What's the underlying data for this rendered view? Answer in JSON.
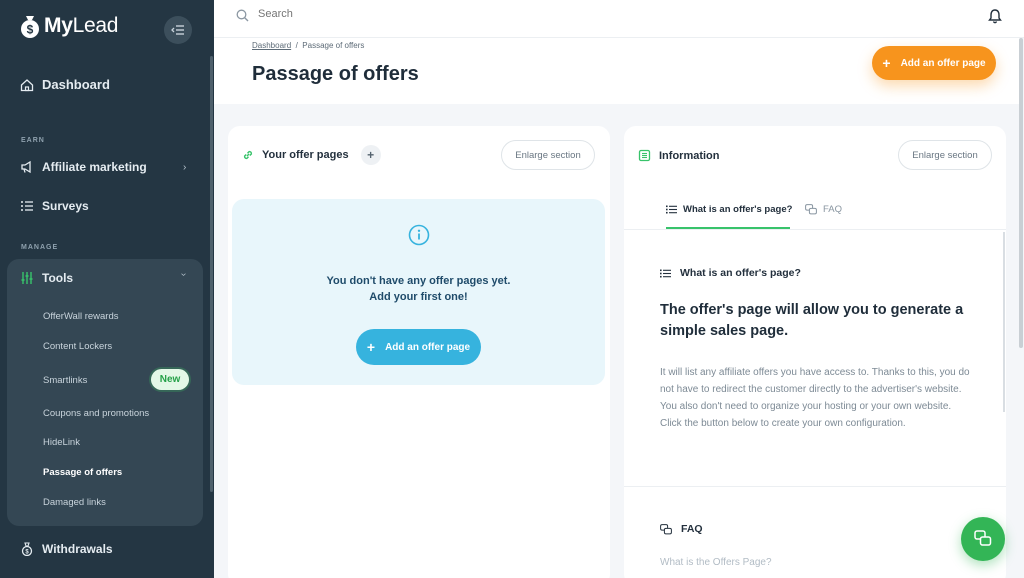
{
  "brand": {
    "name_my": "My",
    "name_lead": "Lead"
  },
  "sidebar": {
    "dashboard": "Dashboard",
    "earn_label": "EARN",
    "affiliate": "Affiliate marketing",
    "surveys": "Surveys",
    "manage_label": "MANAGE",
    "tools": "Tools",
    "tools_items": [
      "OfferWall rewards",
      "Content Lockers",
      "Smartlinks",
      "Coupons and promotions",
      "HideLink",
      "Passage of offers",
      "Damaged links"
    ],
    "new_badge": "New",
    "withdrawals": "Withdrawals"
  },
  "topbar": {
    "search_placeholder": "Search"
  },
  "header": {
    "breadcrumb_home": "Dashboard",
    "breadcrumb_sep": "/",
    "breadcrumb_current": "Passage of offers",
    "title": "Passage of offers",
    "add_button": "Add an offer page"
  },
  "left_card": {
    "title": "Your offer pages",
    "plus": "+",
    "enlarge": "Enlarge section",
    "empty_line1": "You don't have any offer pages yet.",
    "empty_line2": "Add your first one!",
    "add_button": "Add an offer page"
  },
  "right_card": {
    "title": "Information",
    "enlarge": "Enlarge section",
    "tab_what": "What is an offer's page?",
    "tab_faq": "FAQ",
    "section_what": "What is an offer's page?",
    "big_text": "The offer's page will allow you to generate a simple sales page.",
    "paragraph": "It will list any affiliate offers you have access to. Thanks to this, you do not have to redirect the customer directly to the advertiser's website. You also don't need to organize your hosting or your own website. Click the button below to create your own configuration.",
    "section_faq": "FAQ",
    "faq_question": "What is the Offers Page?"
  },
  "colors": {
    "accent_green": "#38c36b",
    "orange": "#f7941d",
    "blue": "#36b3de",
    "sidebar": "#243643"
  }
}
